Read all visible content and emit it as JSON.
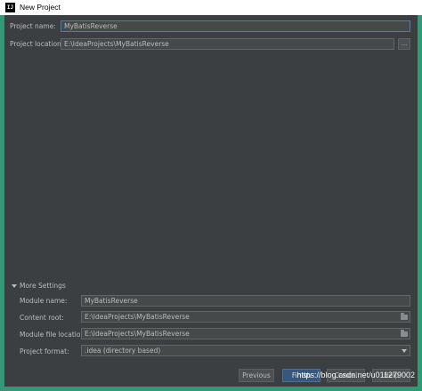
{
  "window": {
    "title": "New Project",
    "app_icon": "intellij-icon"
  },
  "project": {
    "name_label": "Project name:",
    "name_value": "MyBatisReverse",
    "location_label": "Project location:",
    "location_value": "E:\\IdeaProjects\\MyBatisReverse",
    "browse_label": "..."
  },
  "more_settings": {
    "header": "More Settings",
    "module_name_label": "Module name:",
    "module_name_value": "MyBatisReverse",
    "content_root_label": "Content root:",
    "content_root_value": "E:\\IdeaProjects\\MyBatisReverse",
    "module_file_label": "Module file location:",
    "module_file_value": "E:\\IdeaProjects\\MyBatisReverse",
    "format_label": "Project format:",
    "format_value": ".idea (directory based)"
  },
  "buttons": {
    "previous": "Previous",
    "finish": "Finish",
    "cancel": "Cancel",
    "help": "Help"
  },
  "watermark": "https://blog.csdn.net/u011279002",
  "colors": {
    "background": "#3c3f41",
    "frame": "#2f9a73",
    "field": "#45494a",
    "focus_border": "#3d80c5",
    "default_button": "#365880"
  }
}
